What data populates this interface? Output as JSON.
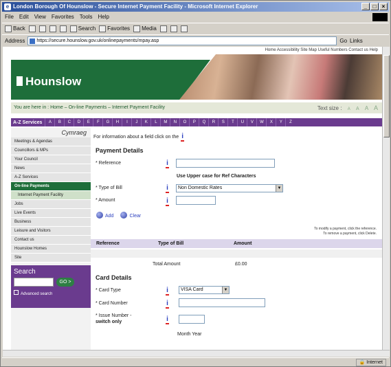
{
  "window": {
    "title": "London Borough Of Hounslow - Secure Internet Payment Facility - Microsoft Internet Explorer",
    "controls": [
      "_",
      "□",
      "×"
    ]
  },
  "menu": [
    "File",
    "Edit",
    "View",
    "Favorites",
    "Tools",
    "Help"
  ],
  "toolbar": {
    "back": "Back",
    "search": "Search",
    "favorites": "Favorites",
    "media": "Media"
  },
  "address": {
    "label": "Address",
    "url": "https://secure.hounslow.gov.uk/onlinepayments/mpay.asp",
    "go": "Go",
    "links": "Links"
  },
  "page": {
    "top_links": "Home  Accessibility  Site Map  Useful Numbers  Contact us  Help",
    "brand": "Hounslow",
    "crumb": {
      "prefix": "You are here in :",
      "items": [
        "Home",
        "On-line Payments",
        "Internet Payment Facility"
      ]
    },
    "text_size": {
      "label": "Text size :",
      "options": [
        "A",
        "A",
        "A",
        "A"
      ]
    },
    "az": {
      "label": "A-Z Services",
      "letters": [
        "A",
        "B",
        "C",
        "D",
        "E",
        "F",
        "G",
        "H",
        "I",
        "J",
        "K",
        "L",
        "M",
        "N",
        "O",
        "P",
        "Q",
        "R",
        "S",
        "T",
        "U",
        "V",
        "W",
        "X",
        "Y",
        "Z"
      ]
    },
    "sidebar": {
      "welsh": "Cymraeg",
      "items": [
        {
          "label": "Meetings & Agendas",
          "state": ""
        },
        {
          "label": "Councillors & MPs",
          "state": ""
        },
        {
          "label": "Your Council",
          "state": ""
        },
        {
          "label": "News",
          "state": ""
        },
        {
          "label": "A-Z Services",
          "state": ""
        },
        {
          "label": "On-line Payments",
          "state": "active"
        },
        {
          "label": "Internet Payment Facility",
          "state": "sub"
        },
        {
          "label": "Jobs",
          "state": ""
        },
        {
          "label": "Live Events",
          "state": ""
        },
        {
          "label": "Business",
          "state": ""
        },
        {
          "label": "Leisure and Visitors",
          "state": ""
        },
        {
          "label": "Contact us",
          "state": ""
        },
        {
          "label": "Hounslow Homes",
          "state": ""
        },
        {
          "label": "Site",
          "state": ""
        }
      ],
      "search_title": "Search",
      "go": "GO >",
      "advanced": "Advanced search"
    },
    "info_line": "For information about a field click on the",
    "payment": {
      "title": "Payment Details",
      "reference_label": "* Reference",
      "reference_value": "",
      "hint": "Use Upper case for Ref Characters",
      "type_label": "* Type of Bill",
      "type_value": "Non Domestic Rates",
      "amount_label": "* Amount",
      "amount_value": "",
      "add": "Add",
      "clear": "Clear"
    },
    "table": {
      "help_line1": "To modify a payment, click the reference.",
      "help_line2": "To remove a payment, click Delete.",
      "columns": [
        "Reference",
        "Type of Bill",
        "Amount"
      ],
      "total_label": "Total Amount",
      "total_value": "£0.00"
    },
    "card": {
      "title": "Card Details",
      "type_label": "* Card Type",
      "type_value": "VISA Card",
      "number_label": "* Card Number",
      "number_value": "",
      "issue_label": "* Issue Number -",
      "issue_label2": "switch only",
      "issue_value": "",
      "month_year": "Month  Year"
    }
  },
  "status": {
    "text": "",
    "zone": "Internet"
  },
  "colors": {
    "green": "#1e6e3a",
    "purple": "#6a3b8e",
    "info_blue": "#2a3fbf"
  }
}
